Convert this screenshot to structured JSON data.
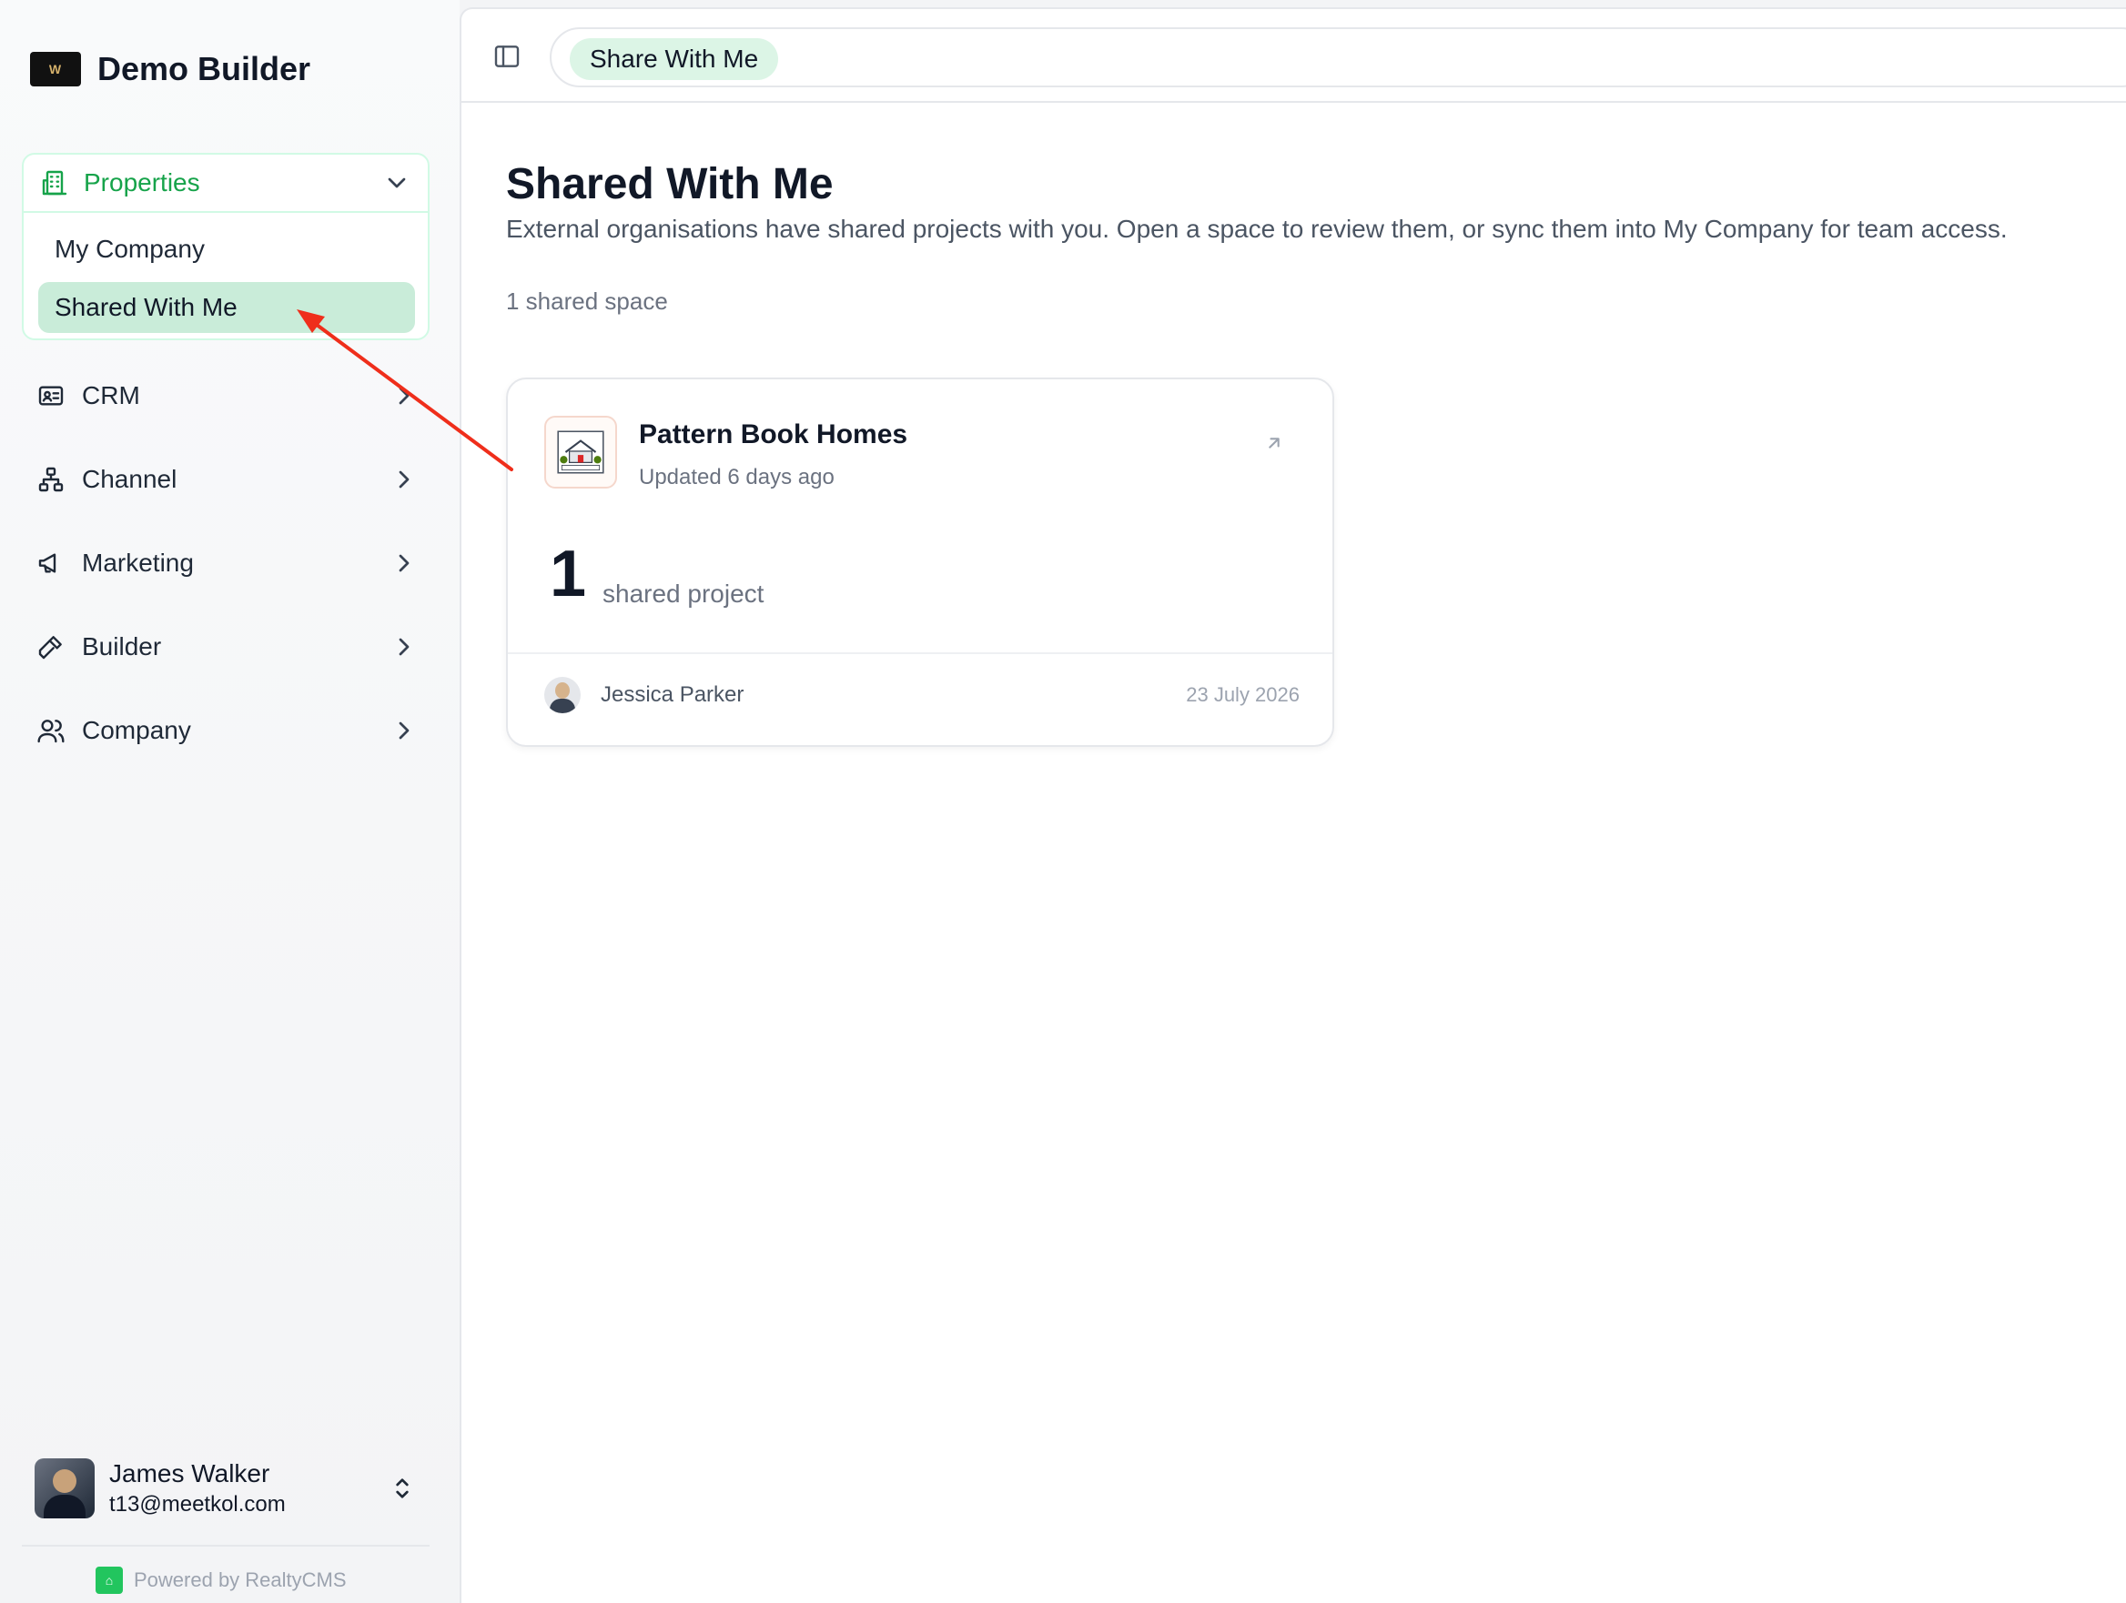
{
  "brand": {
    "name": "Demo Builder",
    "logo_text": "W"
  },
  "sidebar": {
    "group": {
      "label": "Properties",
      "icon": "building-icon",
      "items": [
        {
          "label": "My Company"
        },
        {
          "label": "Shared With Me",
          "active": true
        }
      ]
    },
    "items": [
      {
        "label": "CRM",
        "icon": "id-card-icon"
      },
      {
        "label": "Channel",
        "icon": "network-icon"
      },
      {
        "label": "Marketing",
        "icon": "megaphone-icon"
      },
      {
        "label": "Builder",
        "icon": "hammer-icon"
      },
      {
        "label": "Company",
        "icon": "users-icon"
      }
    ],
    "user": {
      "name": "James Walker",
      "email": "t13@meetkol.com"
    },
    "powered_by": "Powered by RealtyCMS"
  },
  "header": {
    "breadcrumb": "Share With Me"
  },
  "main": {
    "title": "Shared With Me",
    "description": "External organisations have shared projects with you. Open a space to review them, or sync them into My Company for team access.",
    "count_label": "1 shared space",
    "card": {
      "title": "Pattern Book Homes",
      "updated": "Updated 6 days ago",
      "count": "1",
      "count_label": "shared project",
      "owner": "Jessica Parker",
      "date": "23 July 2026"
    }
  },
  "colors": {
    "accent": "#16a34a",
    "active_bg": "#c9ecd9",
    "annotation_arrow": "#ef2e1b"
  }
}
